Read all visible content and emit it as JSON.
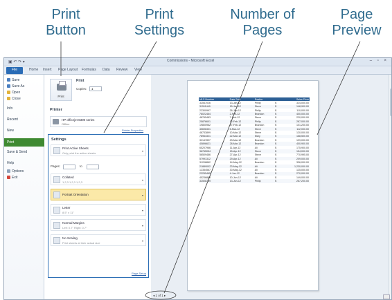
{
  "callouts": {
    "print_button": [
      "Print",
      "Button"
    ],
    "print_settings": [
      "Print",
      "Settings"
    ],
    "number_of_pages": [
      "Number of",
      "Pages"
    ],
    "page_preview": [
      "Page",
      "Preview"
    ]
  },
  "window": {
    "title": "Commissions - Microsoft Excel",
    "controls": "– ▫ ×"
  },
  "ribbon_tabs": [
    "File",
    "Home",
    "Insert",
    "Page Layout",
    "Formulas",
    "Data",
    "Review",
    "View"
  ],
  "backstage_nav": {
    "top_items": [
      "Save",
      "Save As",
      "Open",
      "Close"
    ],
    "main_items": [
      "Info",
      "Recent",
      "New",
      "Print",
      "Save & Send",
      "Help"
    ],
    "bottom_items": [
      "Options",
      "Exit"
    ],
    "selected": "Print"
  },
  "print": {
    "heading": "Print",
    "button_label": "Print",
    "copies_label": "Copies:",
    "copies_value": "1"
  },
  "printer": {
    "heading": "Printer",
    "name": "HP officejet 6300 series",
    "status": "Offline",
    "properties_link": "Printer Properties"
  },
  "settings": {
    "heading": "Settings",
    "rows": [
      {
        "t1": "Print Active Sheets",
        "t2": "Only print the active sheets"
      },
      {
        "t1": "Collated",
        "t2": "1,2,3  1,2,3  1,2,3"
      },
      {
        "t1": "Portrait Orientation",
        "t2": ""
      },
      {
        "t1": "Letter",
        "t2": "8.5\" x 11\""
      },
      {
        "t1": "Normal Margins",
        "t2": "Left: 0.7\"  Right: 0.7\""
      },
      {
        "t1": "No Scaling",
        "t2": "Print sheets at their actual size"
      }
    ],
    "pages_label": "Pages:",
    "to_label": "to",
    "page_setup_link": "Page Setup"
  },
  "page_nav": "◂ 1  of 1 ▸",
  "sheet": {
    "headers": [
      "MLS Number",
      "Date Sold",
      "Realtor",
      "",
      "Sales Price"
    ],
    "rows": [
      [
        "32547026",
        "13-Jan-12",
        "Philip",
        "$",
        "324,000.00"
      ],
      [
        "31511449",
        "15-Jan-12",
        "Steve",
        "$",
        "148,900.00"
      ],
      [
        "22300997",
        "26-Jan-12",
        "Philip",
        "$",
        "110,000.00"
      ],
      [
        "78022464",
        "2-Feb-12",
        "Brandon",
        "$",
        "400,000.00"
      ],
      [
        "48765483",
        "7-Feb-12",
        "Steve",
        "$",
        "220,000.00"
      ],
      [
        "25876601",
        "12-Feb-12",
        "Philip",
        "$",
        "287,000.00"
      ],
      [
        "19800962",
        "17-Feb-12",
        "Brandon",
        "$",
        "101,200.00"
      ],
      [
        "45696331",
        "5-Mar-12",
        "Steve",
        "$",
        "112,000.00"
      ],
      [
        "48733899",
        "10-Mar-12",
        "Steve",
        "$",
        "120,000.00"
      ],
      [
        "78964321",
        "22-Mar-12",
        "Mary",
        "$",
        "168,500.00"
      ],
      [
        "32147897",
        "23-Mar-12",
        "Brandon",
        "$",
        "199,000.00"
      ],
      [
        "45896621",
        "28-Mar-12",
        "Brandon",
        "$",
        "400,900.00"
      ],
      [
        "65207966",
        "11-Apr-12",
        "Ali",
        "$",
        "175,900.00"
      ],
      [
        "36765054",
        "15-Apr-12",
        "Steve",
        "$",
        "154,000.00"
      ],
      [
        "56509486",
        "27-Apr-12",
        "Steve",
        "$",
        "770,995.00"
      ],
      [
        "57991312",
        "29-Apr-12",
        "Ali",
        "$",
        "209,000.00"
      ],
      [
        "31208862",
        "14-May-12",
        "Brandon",
        "$",
        "336,000.00"
      ],
      [
        "21889002",
        "23-May-12",
        "Ali",
        "$",
        "1,230,000.00"
      ],
      [
        "12354567",
        "30-May-12",
        "Ali",
        "$",
        "125,000.00"
      ],
      [
        "23255465",
        "4-Jun-12",
        "Brandon",
        "$",
        "270,000.00"
      ],
      [
        "45236888",
        "10-Jun-12",
        "Ali",
        "$",
        "149,000.00"
      ],
      [
        "32508789",
        "13-Jun-12",
        "Philip",
        "$",
        "267,200.00"
      ]
    ]
  }
}
